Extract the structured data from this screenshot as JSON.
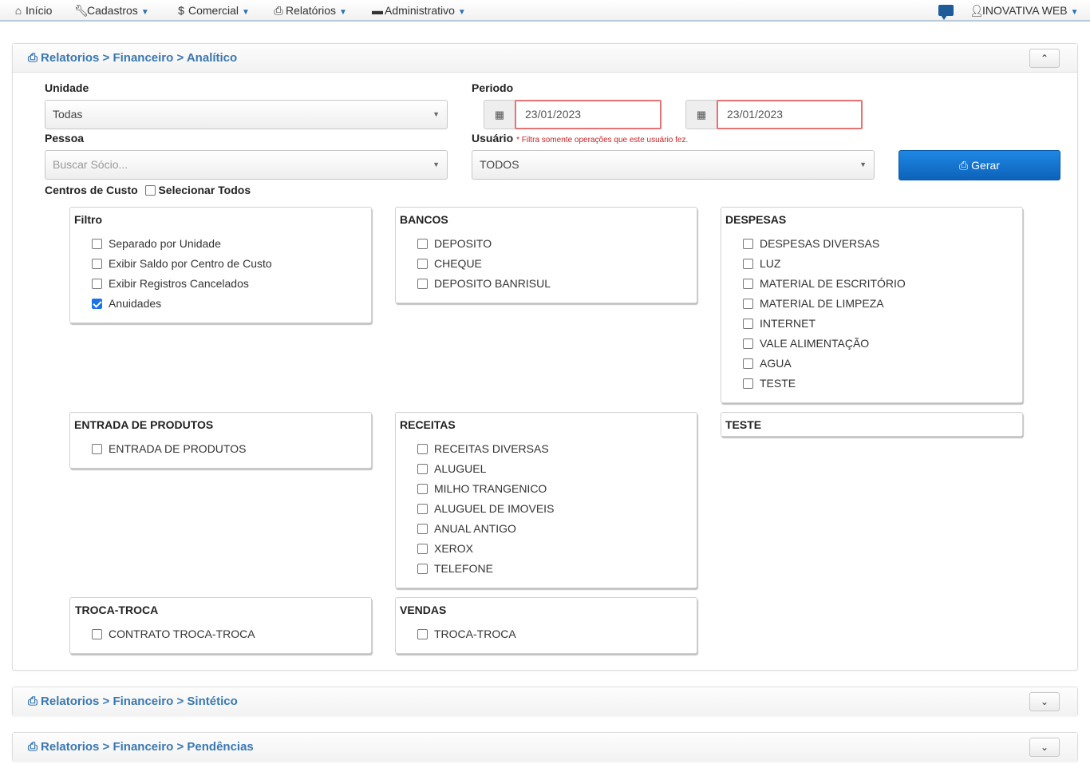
{
  "nav": {
    "items": [
      {
        "label": "Início",
        "icon": "home-icon"
      },
      {
        "label": "Cadastros",
        "icon": "wrench-icon"
      },
      {
        "label": "Comercial",
        "icon": "dollar-icon"
      },
      {
        "label": "Relatórios",
        "icon": "print-icon"
      },
      {
        "label": "Administrativo",
        "icon": "briefcase-icon"
      }
    ],
    "user": "INOVATIVA WEB",
    "chat_icon": "chat-icon"
  },
  "panel_main": {
    "title": "Relatorios > Financeiro > Analítico",
    "toggle": "⌃"
  },
  "form": {
    "unidade_label": "Unidade",
    "unidade_value": "Todas",
    "periodo_label": "Periodo",
    "date_start": "23/01/2023",
    "date_end": "23/01/2023",
    "pessoa_label": "Pessoa",
    "pessoa_placeholder": "Buscar Sócio...",
    "usuario_label": "Usuário",
    "usuario_hint": "* Filtra somente operações que este usuário fez.",
    "usuario_value": "TODOS",
    "gerar_label": "Gerar",
    "centros_label": "Centros de Custo",
    "selecionar_todos": "Selecionar Todos"
  },
  "boxes": {
    "filtro": {
      "title": "Filtro",
      "items": [
        {
          "label": "Separado por Unidade",
          "checked": false
        },
        {
          "label": "Exibir Saldo por Centro de Custo",
          "checked": false
        },
        {
          "label": "Exibir Registros Cancelados",
          "checked": false
        },
        {
          "label": "Anuidades",
          "checked": true
        }
      ]
    },
    "bancos": {
      "title": "BANCOS",
      "items": [
        "DEPOSITO",
        "CHEQUE",
        "DEPOSITO BANRISUL"
      ]
    },
    "despesas": {
      "title": "DESPESAS",
      "items": [
        "DESPESAS DIVERSAS",
        "LUZ",
        "MATERIAL DE ESCRITÓRIO",
        "MATERIAL DE LIMPEZA",
        "INTERNET",
        "VALE ALIMENTAÇÃO",
        "AGUA",
        "TESTE"
      ]
    },
    "entrada": {
      "title": "ENTRADA DE PRODUTOS",
      "items": [
        "ENTRADA DE PRODUTOS"
      ]
    },
    "receitas": {
      "title": "RECEITAS",
      "items": [
        "RECEITAS DIVERSAS",
        "ALUGUEL",
        "MILHO TRANGENICO",
        "ALUGUEL DE IMOVEIS",
        "ANUAL ANTIGO",
        "XEROX",
        "TELEFONE"
      ]
    },
    "teste": {
      "title": "TESTE",
      "items": []
    },
    "troca": {
      "title": "TROCA-TROCA",
      "items": [
        "CONTRATO TROCA-TROCA"
      ]
    },
    "vendas": {
      "title": "VENDAS",
      "items": [
        "TROCA-TROCA"
      ]
    }
  },
  "panel_sintetico": {
    "title": "Relatorios > Financeiro > Sintético",
    "toggle": "⌄"
  },
  "panel_pendencias": {
    "title": "Relatorios > Financeiro > Pendências",
    "toggle": "⌄"
  }
}
